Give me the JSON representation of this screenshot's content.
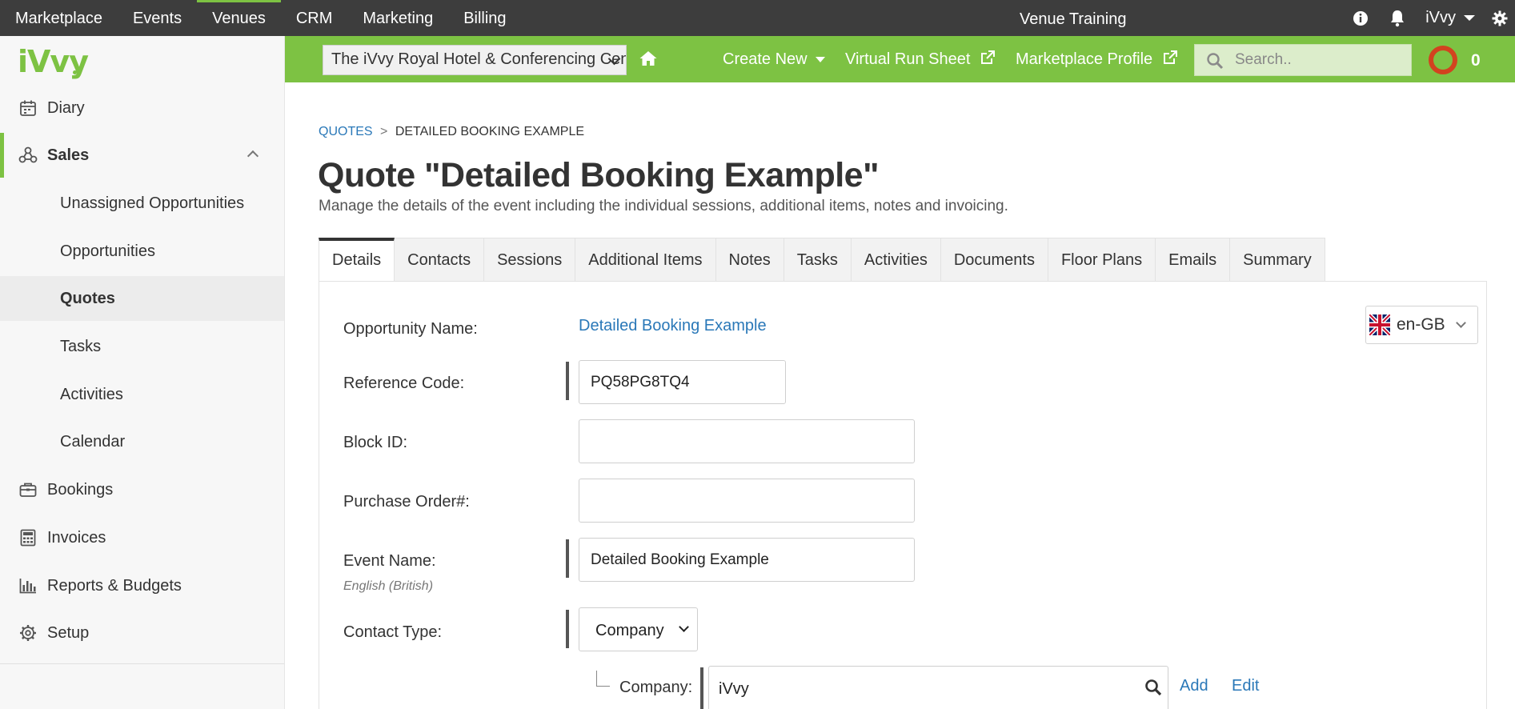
{
  "topnav": {
    "items": [
      "Marketplace",
      "Events",
      "Venues",
      "CRM",
      "Marketing",
      "Billing"
    ],
    "active_index": 2,
    "center_title": "Venue Training",
    "user_label": "iVvy"
  },
  "sidebar": {
    "logo_text": "iVvy",
    "items": [
      {
        "label": "Diary",
        "icon": "calendar-icon"
      },
      {
        "label": "Sales",
        "icon": "network-icon",
        "expanded": true
      },
      {
        "label": "Bookings",
        "icon": "briefcase-icon"
      },
      {
        "label": "Invoices",
        "icon": "calculator-icon"
      },
      {
        "label": "Reports & Budgets",
        "icon": "bar-chart-icon"
      },
      {
        "label": "Setup",
        "icon": "gear-icon"
      }
    ],
    "sales_sub": [
      "Unassigned Opportunities",
      "Opportunities",
      "Quotes",
      "Tasks",
      "Activities",
      "Calendar"
    ],
    "current_sub": "Quotes",
    "collapse_glyph": "«"
  },
  "greenbar": {
    "venue_select": "The iVvy Royal Hotel & Conferencing Centre",
    "create_new": "Create New",
    "virtual_run_sheet": "Virtual Run Sheet",
    "marketplace_profile": "Marketplace Profile",
    "search_placeholder": "Search..",
    "notification_count": "0",
    "accent_color": "#7dc243"
  },
  "main": {
    "breadcrumb": {
      "root": "QUOTES",
      "separator": ">",
      "current": "DETAILED BOOKING EXAMPLE"
    },
    "title": "Quote \"Detailed Booking Example\"",
    "description": "Manage the details of the event including the individual sessions, additional items, notes and invoicing.",
    "tabs": [
      "Details",
      "Contacts",
      "Sessions",
      "Additional Items",
      "Notes",
      "Tasks",
      "Activities",
      "Documents",
      "Floor Plans",
      "Emails",
      "Summary"
    ],
    "active_tab": "Details",
    "language": "en-GB",
    "form": {
      "opportunity_name_label": "Opportunity Name:",
      "opportunity_name_value": "Detailed Booking Example",
      "reference_code_label": "Reference Code:",
      "reference_code_value": "PQ58PG8TQ4",
      "block_id_label": "Block ID:",
      "block_id_value": "",
      "purchase_order_label": "Purchase Order#:",
      "purchase_order_value": "",
      "event_name_label": "Event Name:",
      "event_name_sublabel": "English (British)",
      "event_name_value": "Detailed Booking Example",
      "contact_type_label": "Contact Type:",
      "contact_type_value": "Company",
      "company_label": "Company:",
      "company_value": "iVvy",
      "add_link": "Add",
      "edit_link": "Edit"
    }
  }
}
